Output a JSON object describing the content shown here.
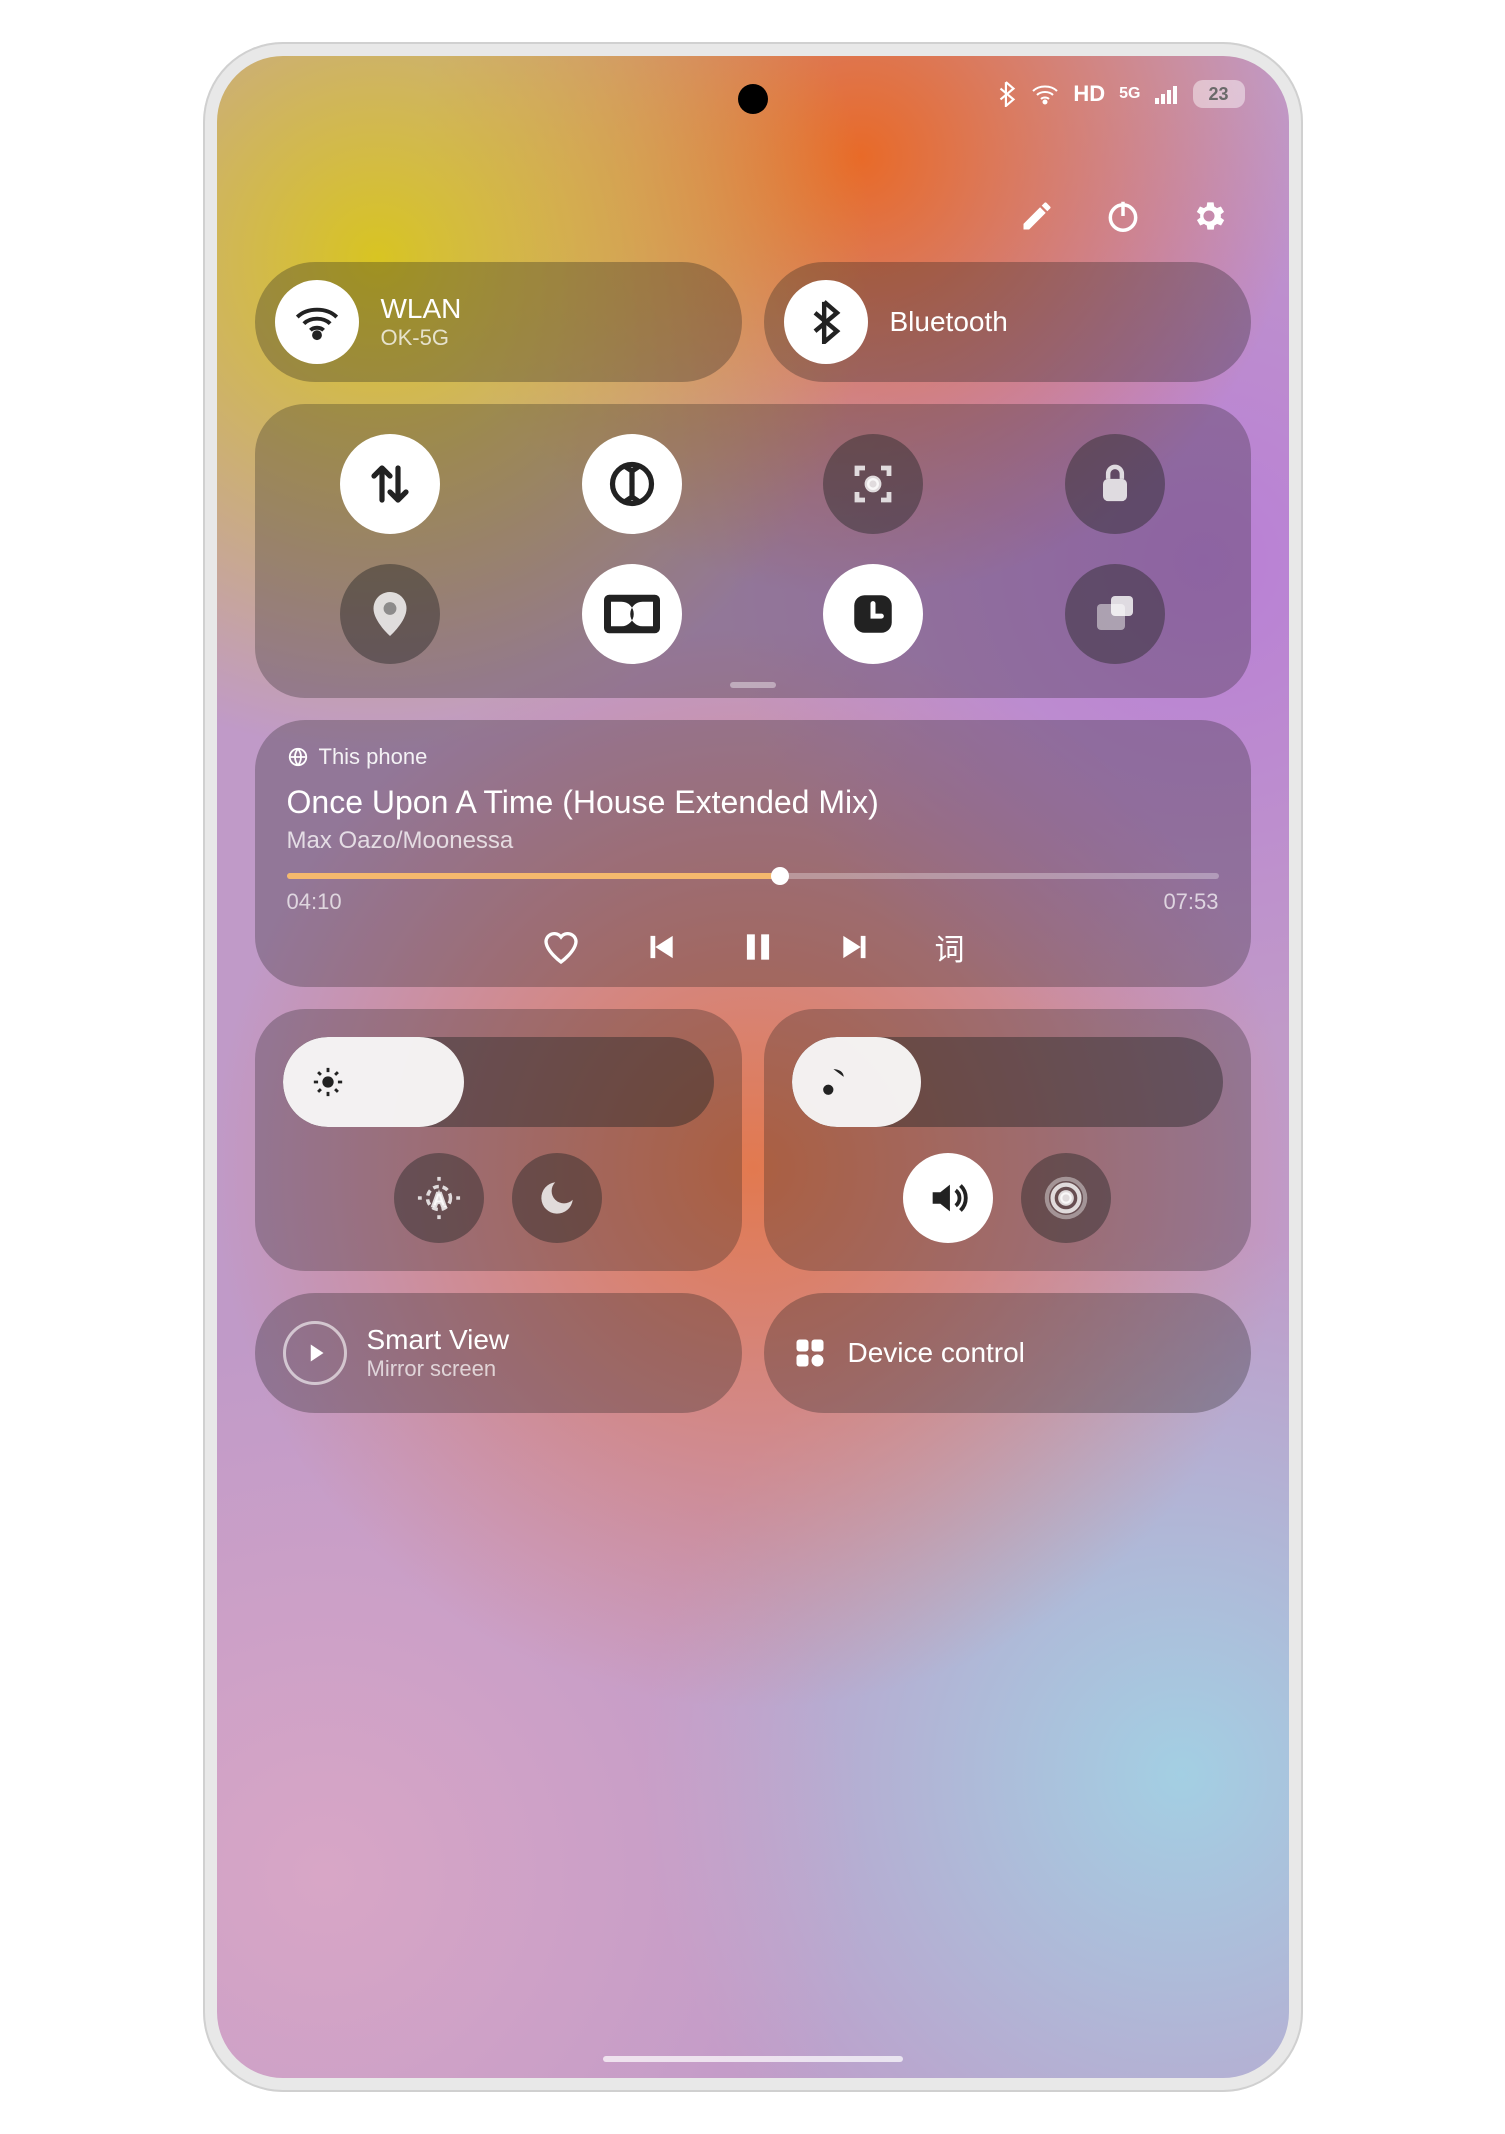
{
  "status": {
    "hd_label": "HD",
    "net_label": "5G",
    "battery_pct": "23"
  },
  "header": {
    "edit": "edit",
    "power": "power",
    "settings": "settings"
  },
  "tiles": {
    "wlan": {
      "title": "WLAN",
      "subtitle": "OK-5G"
    },
    "bluetooth": {
      "title": "Bluetooth"
    }
  },
  "grid": [
    {
      "name": "mobile-data",
      "on": true
    },
    {
      "name": "sync",
      "on": true
    },
    {
      "name": "screenshot",
      "on": false
    },
    {
      "name": "rotation-lock",
      "on": false
    },
    {
      "name": "location",
      "on": false
    },
    {
      "name": "dolby",
      "on": true
    },
    {
      "name": "clock",
      "on": true
    },
    {
      "name": "floating-window",
      "on": false
    }
  ],
  "music": {
    "device_label": "This phone",
    "title": "Once Upon A Time (House Extended Mix)",
    "artist": "Max Oazo/Moonessa",
    "elapsed": "04:10",
    "total": "07:53",
    "progress_pct": 53,
    "lyrics_label": "词"
  },
  "brightness": {
    "level_pct": 42
  },
  "volume": {
    "level_pct": 30
  },
  "bottom": {
    "smartview": {
      "title": "Smart View",
      "subtitle": "Mirror screen"
    },
    "devicecontrol": {
      "title": "Device control"
    }
  }
}
